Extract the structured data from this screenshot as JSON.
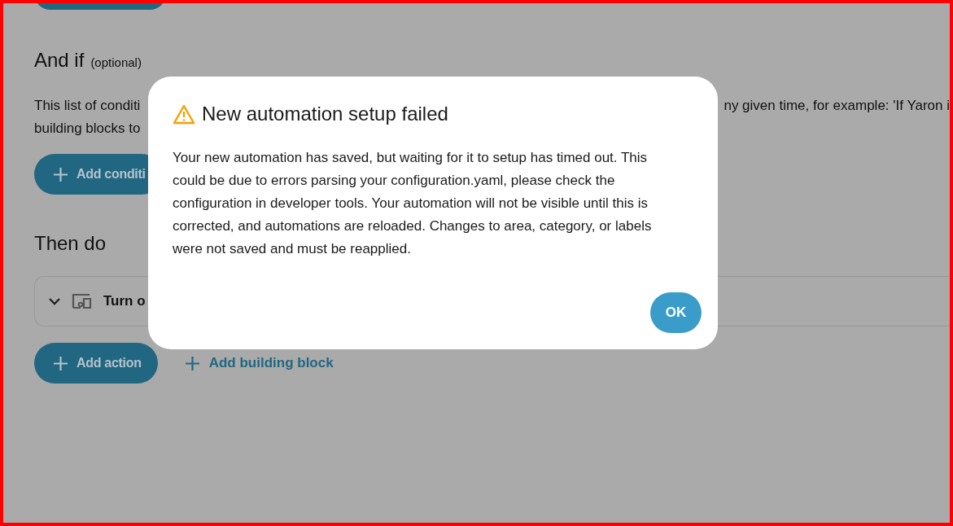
{
  "page": {
    "conditions_section": {
      "title": "And if",
      "title_note": "(optional)",
      "description_left": [
        "This list of conditi",
        "building blocks to"
      ],
      "description_right": "ny given time, for example: 'If Yaron i",
      "add_button": "Add conditi"
    },
    "actions_section": {
      "title": "Then do",
      "actions": [
        {
          "label": "Turn o"
        }
      ],
      "add_button": "Add action",
      "building_block_link": "Add building block"
    }
  },
  "dialog": {
    "title": "New automation setup failed",
    "message": "Your new automation has saved, but waiting for it to setup has timed out. This could be due to errors parsing your configuration.yaml, please check the configuration in developer tools. Your automation will not be visible until this is corrected, and automations are reloaded. Changes to area, category, or labels were not saved and must be reapplied.",
    "buttons": [
      "OK"
    ]
  }
}
